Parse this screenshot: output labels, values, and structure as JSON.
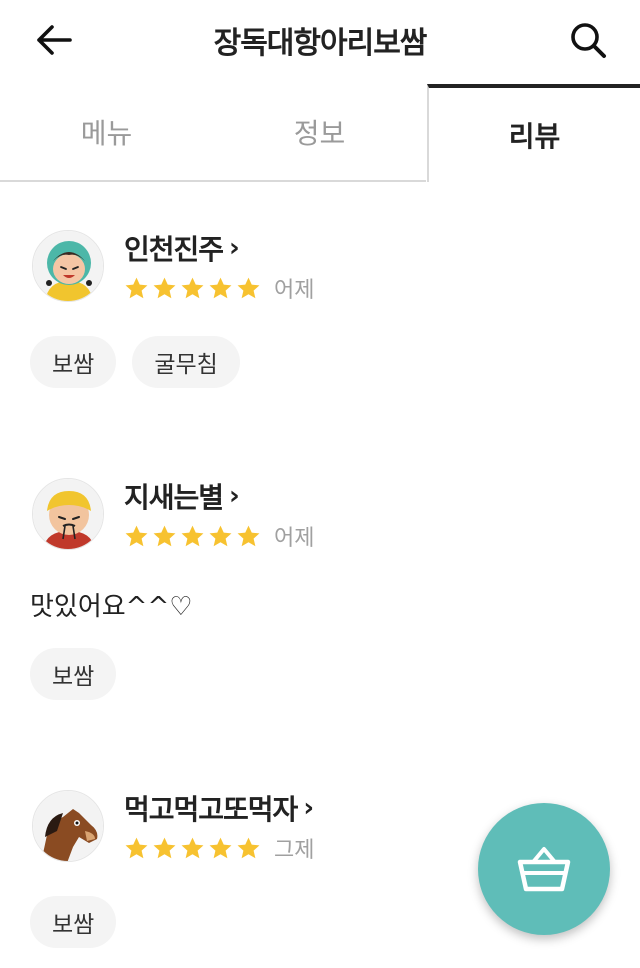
{
  "header": {
    "title": "장독대항아리보쌈",
    "back_icon": "arrow-left-icon",
    "search_icon": "search-icon"
  },
  "tabs": [
    {
      "label": "메뉴",
      "active": false
    },
    {
      "label": "정보",
      "active": false
    },
    {
      "label": "리뷰",
      "active": true
    }
  ],
  "reviews": [
    {
      "nickname": "인천진주",
      "chevron": "›",
      "rating": 5,
      "date": "어제",
      "comment": "",
      "tags": [
        "보쌈",
        "굴무침"
      ],
      "avatar": "girl-avatar"
    },
    {
      "nickname": "지새는별",
      "chevron": "›",
      "rating": 5,
      "date": "어제",
      "comment": "맛있어요^^♡",
      "tags": [
        "보쌈"
      ],
      "avatar": "man-avatar"
    },
    {
      "nickname": "먹고먹고또먹자",
      "chevron": "›",
      "rating": 5,
      "date": "그제",
      "comment": "",
      "tags": [
        "보쌈"
      ],
      "avatar": "horse-avatar"
    }
  ],
  "colors": {
    "star": "#f7c230",
    "fab": "#5fbdb8",
    "tag_bg": "#f4f4f4",
    "muted": "#a0a0a0"
  },
  "fab": {
    "icon": "basket-icon"
  }
}
